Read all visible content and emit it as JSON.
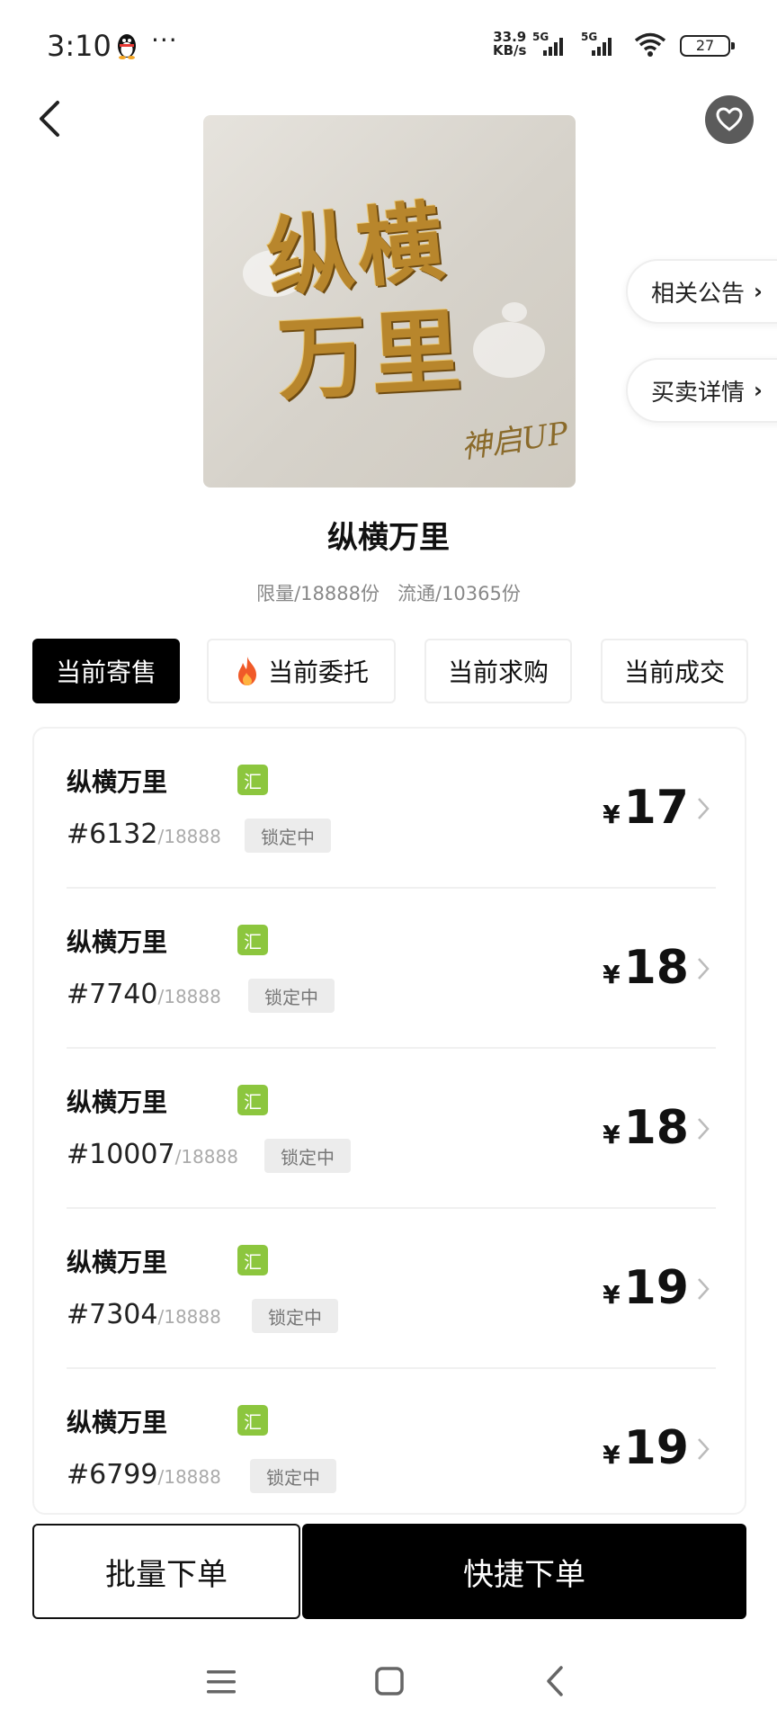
{
  "status_bar": {
    "time": "3:10",
    "dots": "···",
    "speed_value": "33.9",
    "speed_unit": "KB/s",
    "network1": "5G",
    "network2": "5G",
    "battery": "27",
    "icons": [
      "qq-penguin-icon",
      "signal-icon",
      "signal-icon",
      "wifi-icon",
      "battery-icon"
    ]
  },
  "header": {
    "back_icon": "back-arrow-icon",
    "favorite_icon": "heart-icon"
  },
  "cover": {
    "line1": "纵横",
    "line2": "万里",
    "signature": "神启UP"
  },
  "side_tabs": [
    {
      "label": "相关公告",
      "chevron": "›"
    },
    {
      "label": "买卖详情",
      "chevron": "›"
    }
  ],
  "item": {
    "name": "纵横万里",
    "limit": "限量/18888份",
    "circulation": "流通/10365份"
  },
  "tabs": [
    {
      "label": "当前寄售",
      "active": true
    },
    {
      "label": "当前委托",
      "icon": "fire-icon"
    },
    {
      "label": "当前求购"
    },
    {
      "label": "当前成交"
    }
  ],
  "listings": [
    {
      "name": "纵横万里",
      "badge": "汇",
      "serial": "#6132",
      "total": "/18888",
      "status": "锁定中",
      "currency": "¥",
      "price": "17"
    },
    {
      "name": "纵横万里",
      "badge": "汇",
      "serial": "#7740",
      "total": "/18888",
      "status": "锁定中",
      "currency": "¥",
      "price": "18"
    },
    {
      "name": "纵横万里",
      "badge": "汇",
      "serial": "#10007",
      "total": "/18888",
      "status": "锁定中",
      "currency": "¥",
      "price": "18"
    },
    {
      "name": "纵横万里",
      "badge": "汇",
      "serial": "#7304",
      "total": "/18888",
      "status": "锁定中",
      "currency": "¥",
      "price": "19"
    },
    {
      "name": "纵横万里",
      "badge": "汇",
      "serial": "#6799",
      "total": "/18888",
      "status": "锁定中",
      "currency": "¥",
      "price": "19"
    }
  ],
  "bottom": {
    "batch_label": "批量下单",
    "quick_label": "快捷下单"
  },
  "nav": {
    "icons": [
      "menu-icon",
      "home-icon",
      "back-icon"
    ]
  },
  "colors": {
    "primary": "#000000",
    "badge_green": "#8cc63e",
    "lock_bg": "#ececec",
    "cover_gold": "#b8862c",
    "fire": "#f05a28"
  }
}
